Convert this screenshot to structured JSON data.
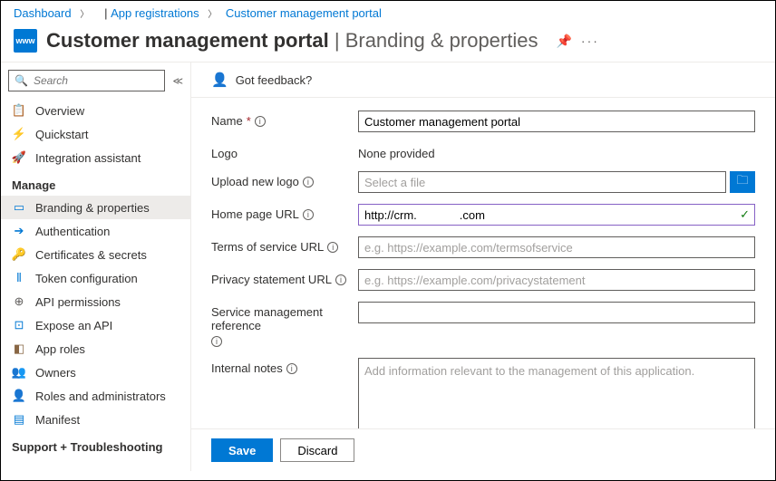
{
  "breadcrumb": {
    "items": [
      "Dashboard",
      "App registrations",
      "Customer management portal"
    ]
  },
  "header": {
    "app_name": "Customer management portal",
    "page_title": "Branding & properties",
    "icon_label": "www"
  },
  "sidebar": {
    "search_placeholder": "Search",
    "top": [
      {
        "icon": "📋",
        "color": "#0078d4",
        "label": "Overview"
      },
      {
        "icon": "⚡",
        "color": "#f7a210",
        "label": "Quickstart"
      },
      {
        "icon": "🚀",
        "color": "#d83b01",
        "label": "Integration assistant"
      }
    ],
    "manage_header": "Manage",
    "manage": [
      {
        "icon": "▭",
        "color": "#0078d4",
        "label": "Branding & properties",
        "active": true
      },
      {
        "icon": "➔",
        "color": "#0078d4",
        "label": "Authentication"
      },
      {
        "icon": "🔑",
        "color": "#f7a210",
        "label": "Certificates & secrets"
      },
      {
        "icon": "⫴",
        "color": "#0078d4",
        "label": "Token configuration"
      },
      {
        "icon": "⊕",
        "color": "#605e5c",
        "label": "API permissions"
      },
      {
        "icon": "⊡",
        "color": "#0078d4",
        "label": "Expose an API"
      },
      {
        "icon": "◧",
        "color": "#886644",
        "label": "App roles"
      },
      {
        "icon": "👥",
        "color": "#0078d4",
        "label": "Owners"
      },
      {
        "icon": "👤",
        "color": "#886644",
        "label": "Roles and administrators"
      },
      {
        "icon": "▤",
        "color": "#0078d4",
        "label": "Manifest"
      }
    ],
    "support_header": "Support + Troubleshooting"
  },
  "feedback": {
    "label": "Got feedback?"
  },
  "form": {
    "name": {
      "label": "Name",
      "value": "Customer management portal"
    },
    "logo": {
      "label": "Logo",
      "value": "None provided"
    },
    "upload": {
      "label": "Upload new logo",
      "placeholder": "Select a file"
    },
    "home": {
      "label": "Home page URL",
      "value": "http://crm.             .com"
    },
    "tos": {
      "label": "Terms of service URL",
      "placeholder": "e.g. https://example.com/termsofservice"
    },
    "privacy": {
      "label": "Privacy statement URL",
      "placeholder": "e.g. https://example.com/privacystatement"
    },
    "svcref": {
      "label": "Service management reference"
    },
    "notes": {
      "label": "Internal notes",
      "placeholder": "Add information relevant to the management of this application."
    }
  },
  "footer": {
    "save": "Save",
    "discard": "Discard"
  }
}
